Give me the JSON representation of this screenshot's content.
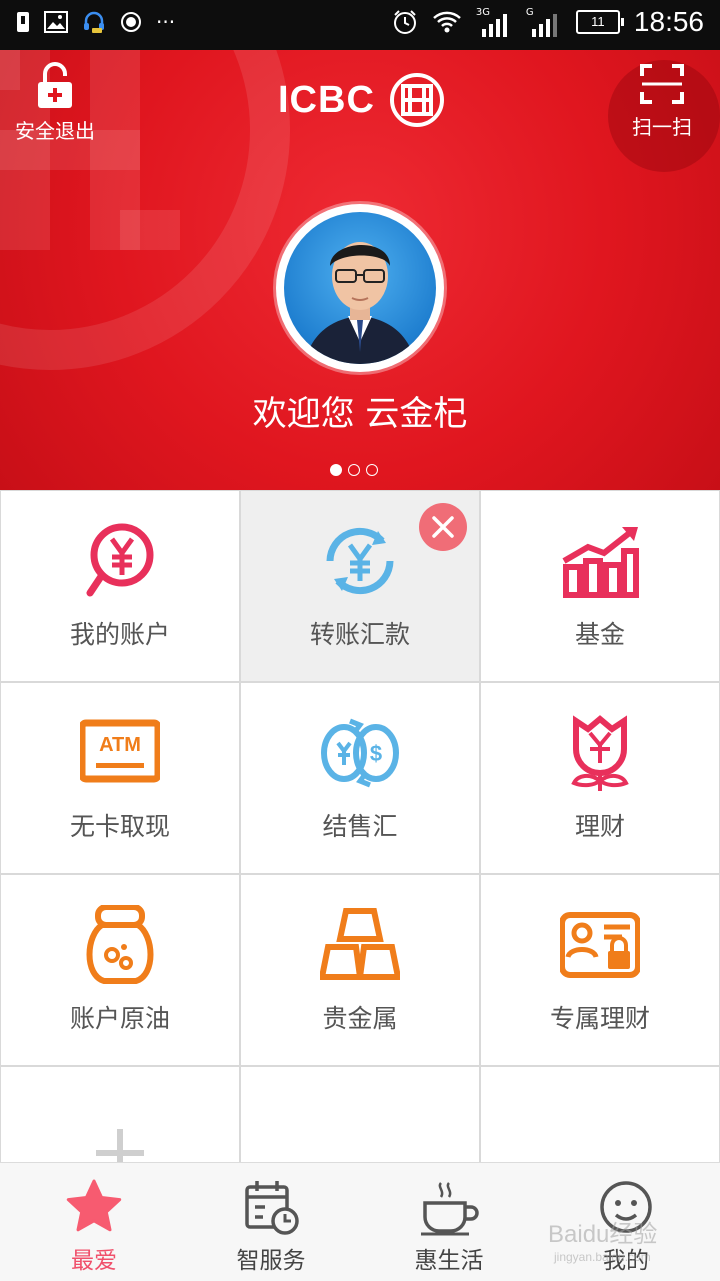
{
  "status_bar": {
    "time": "18:56",
    "battery": "11",
    "left_icons": [
      "download-icon",
      "image-icon",
      "headset-icon",
      "record-icon"
    ],
    "more": "···",
    "signal_1": "3G",
    "signal_2": "G"
  },
  "header": {
    "brand": "ICBC",
    "logout_label": "安全退出",
    "scan_label": "扫一扫",
    "welcome": "欢迎您 云金杞",
    "carousel_pages": 3,
    "carousel_active": 1,
    "colors": {
      "background": "#e0161f",
      "accent_red": "#e8305b",
      "accent_blue": "#5ab3e6",
      "accent_orange": "#f07d1a"
    }
  },
  "grid": {
    "items": [
      {
        "label": "我的账户",
        "icon": "account-icon"
      },
      {
        "label": "转账汇款",
        "icon": "transfer-icon"
      },
      {
        "label": "基金",
        "icon": "fund-chart-icon"
      },
      {
        "label": "无卡取现",
        "icon": "atm-icon",
        "icon_text": "ATM"
      },
      {
        "label": "结售汇",
        "icon": "exchange-icon"
      },
      {
        "label": "理财",
        "icon": "rose-finance-icon"
      },
      {
        "label": "账户原油",
        "icon": "oil-jar-icon"
      },
      {
        "label": "贵金属",
        "icon": "gold-bars-icon"
      },
      {
        "label": "专属理财",
        "icon": "exclusive-finance-icon"
      },
      {
        "label": "",
        "icon": "add-icon"
      },
      {
        "label": "",
        "icon": ""
      },
      {
        "label": "",
        "icon": ""
      }
    ]
  },
  "bottom_nav": {
    "items": [
      {
        "label": "最爱",
        "icon": "star-icon",
        "active": true
      },
      {
        "label": "智服务",
        "icon": "calendar-clock-icon",
        "active": false
      },
      {
        "label": "惠生活",
        "icon": "coffee-cup-icon",
        "active": false
      },
      {
        "label": "我的",
        "icon": "smiley-icon",
        "active": false
      }
    ]
  },
  "watermark": {
    "text": "Baidu经验",
    "sub": "jingyan.baidu.com"
  }
}
